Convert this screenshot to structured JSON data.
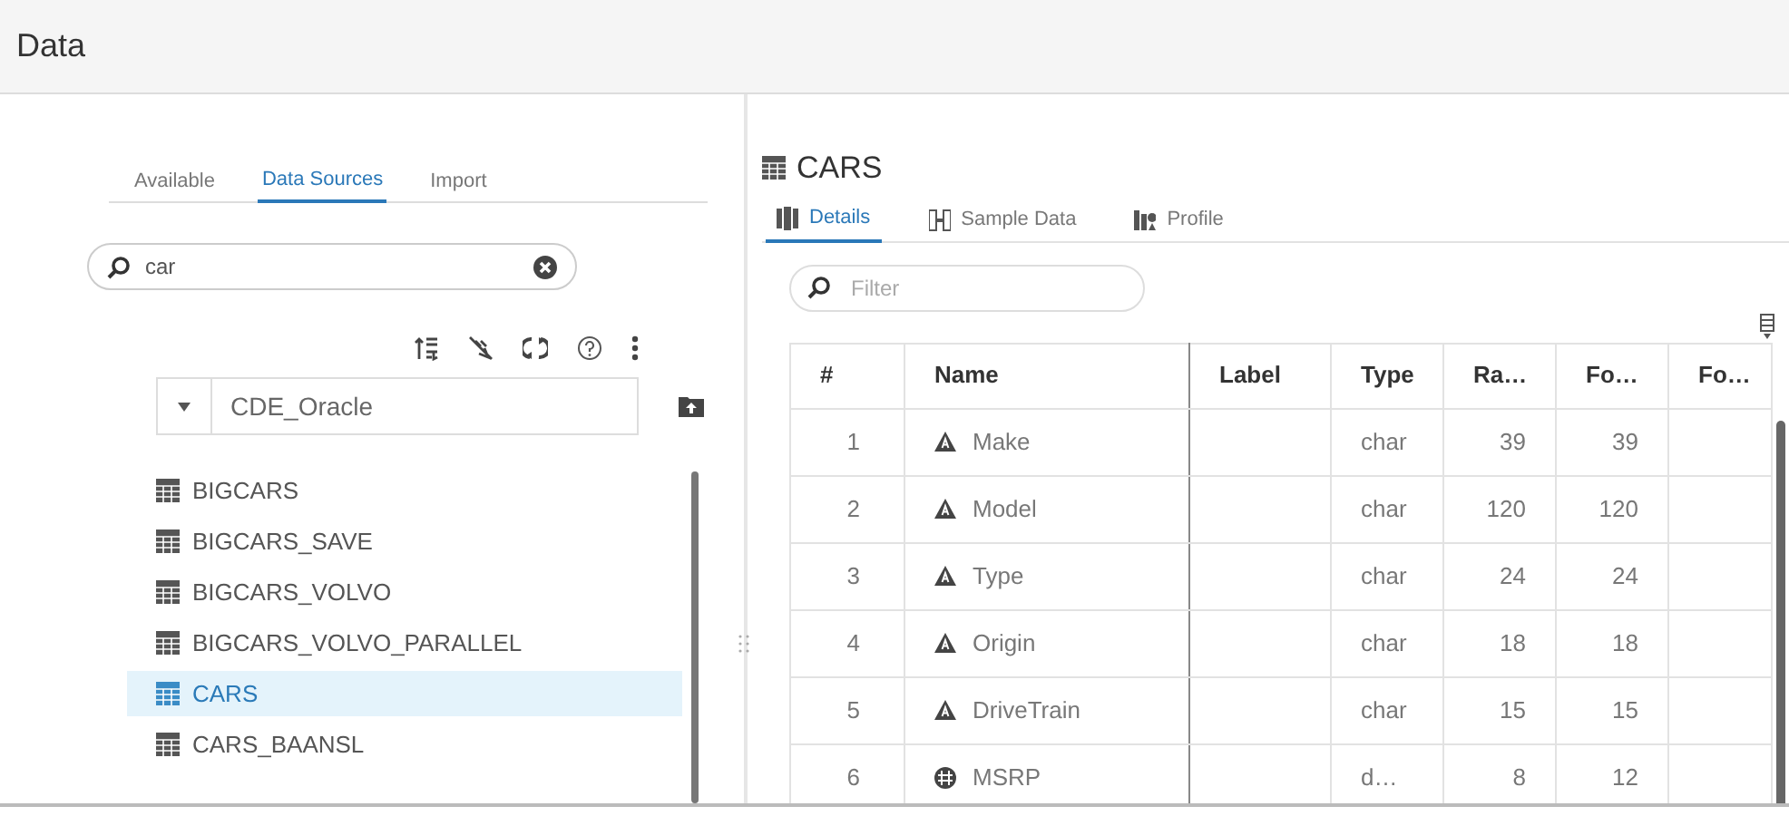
{
  "window": {
    "title": "Data"
  },
  "left_tabs": [
    {
      "label": "Available",
      "selected": false
    },
    {
      "label": "Data Sources",
      "selected": true
    },
    {
      "label": "Import",
      "selected": false
    }
  ],
  "search": {
    "value": "car"
  },
  "source": {
    "value": "CDE_Oracle"
  },
  "tables": [
    {
      "name": "BIGCARS",
      "selected": false
    },
    {
      "name": "BIGCARS_SAVE",
      "selected": false
    },
    {
      "name": "BIGCARS_VOLVO",
      "selected": false
    },
    {
      "name": "BIGCARS_VOLVO_PARALLEL",
      "selected": false
    },
    {
      "name": "CARS",
      "selected": true
    },
    {
      "name": "CARS_BAANSL",
      "selected": false
    }
  ],
  "detail": {
    "title": "CARS",
    "tabs": [
      {
        "label": "Details",
        "selected": true
      },
      {
        "label": "Sample Data",
        "selected": false
      },
      {
        "label": "Profile",
        "selected": false
      }
    ],
    "filter": {
      "placeholder": "Filter"
    },
    "columns": [
      "#",
      "Name",
      "Label",
      "Type",
      "Ra…",
      "Fo…",
      "Fo…"
    ],
    "rows": [
      {
        "num": "1",
        "kind": "character",
        "name": "Make",
        "type": "char",
        "c5": "39",
        "c6": "39"
      },
      {
        "num": "2",
        "kind": "character",
        "name": "Model",
        "type": "char",
        "c5": "120",
        "c6": "120"
      },
      {
        "num": "3",
        "kind": "character",
        "name": "Type",
        "type": "char",
        "c5": "24",
        "c6": "24"
      },
      {
        "num": "4",
        "kind": "character",
        "name": "Origin",
        "type": "char",
        "c5": "18",
        "c6": "18"
      },
      {
        "num": "5",
        "kind": "character",
        "name": "DriveTrain",
        "type": "char",
        "c5": "15",
        "c6": "15"
      },
      {
        "num": "6",
        "kind": "numeric",
        "name": "MSRP",
        "type": "d…",
        "c5": "8",
        "c6": "12"
      }
    ]
  }
}
